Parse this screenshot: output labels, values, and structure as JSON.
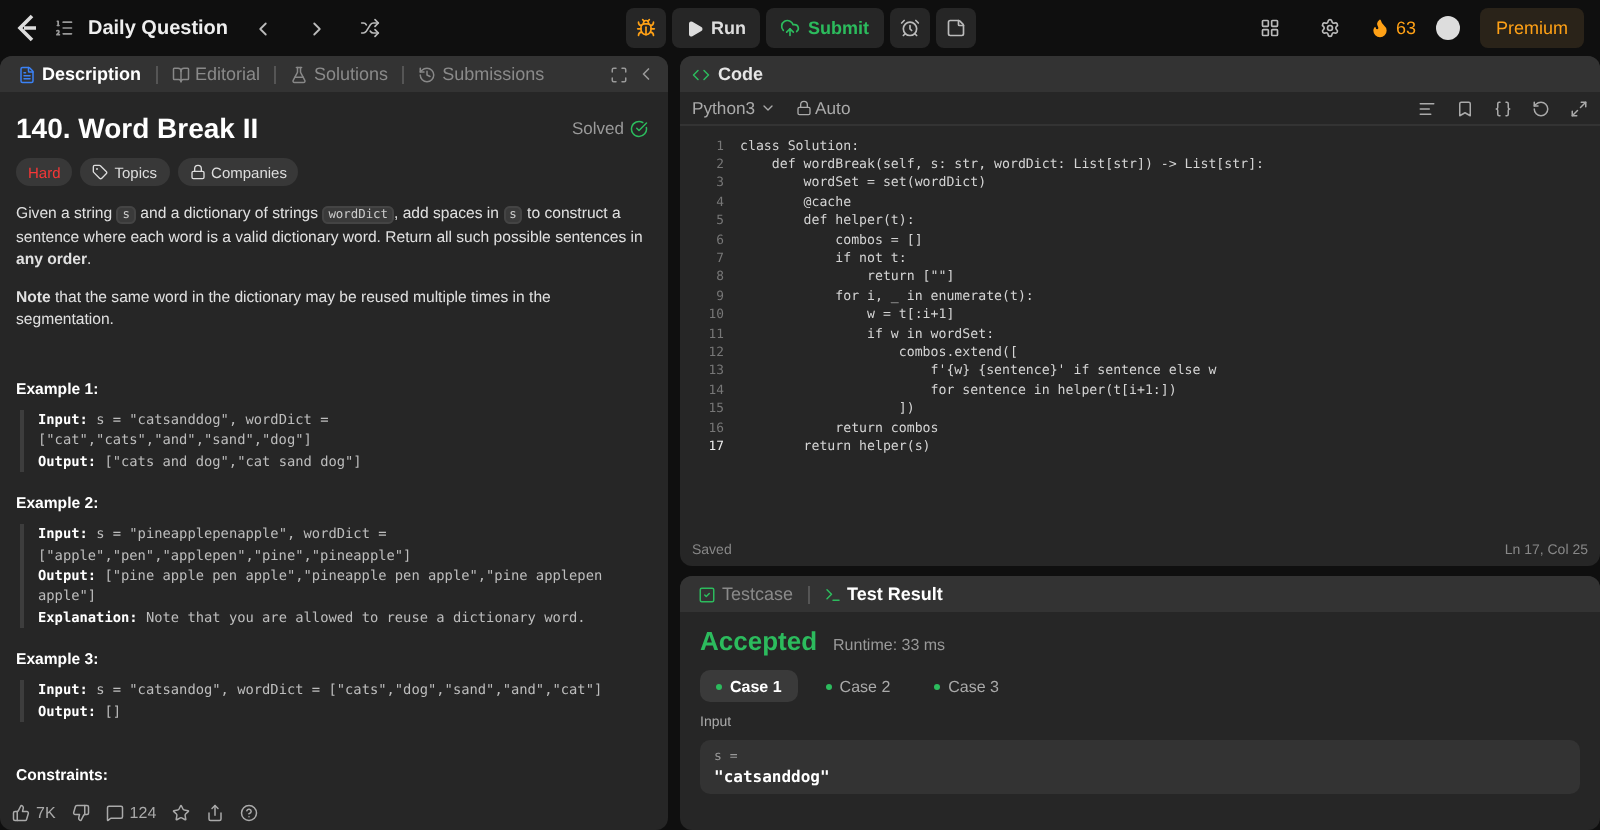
{
  "topbar": {
    "title": "Daily Question",
    "run": "Run",
    "submit": "Submit",
    "streak": "63",
    "premium": "Premium"
  },
  "left_tabs": [
    {
      "label": "Description",
      "selected": true
    },
    {
      "label": "Editorial",
      "selected": false
    },
    {
      "label": "Solutions",
      "selected": false
    },
    {
      "label": "Submissions",
      "selected": false
    }
  ],
  "problem": {
    "title": "140. Word Break II",
    "status": "Solved",
    "difficulty": "Hard",
    "tags": [
      "Topics",
      "Companies"
    ],
    "description": [
      {
        "kind": "text",
        "text": "Given a string "
      },
      {
        "kind": "code",
        "text": "s"
      },
      {
        "kind": "text",
        "text": " and a dictionary of strings "
      },
      {
        "kind": "code",
        "text": "wordDict"
      },
      {
        "kind": "text",
        "text": ", add spaces in "
      },
      {
        "kind": "code",
        "text": "s"
      },
      {
        "kind": "text",
        "text": " to construct a sentence where each word is a valid dictionary word. Return all such possible sentences in "
      },
      {
        "kind": "bold",
        "text": "any order"
      },
      {
        "kind": "text",
        "text": "."
      }
    ],
    "note": "**Note** that the same word in the dictionary may be reused multiple times in the segmentation.",
    "examples": [
      {
        "title": "Example 1:",
        "lines": [
          {
            "label": "Input:",
            "text": "s = \"catsanddog\", wordDict ="
          },
          {
            "text": "[\"cat\",\"cats\",\"and\",\"sand\",\"dog\"]"
          },
          {
            "label": "Output:",
            "text": "[\"cats and dog\",\"cat sand dog\"]"
          }
        ]
      },
      {
        "title": "Example 2:",
        "lines": [
          {
            "label": "Input:",
            "text": "s = \"pineapplepenapple\", wordDict ="
          },
          {
            "text": "[\"apple\",\"pen\",\"applepen\",\"pine\",\"pineapple\"]"
          },
          {
            "label": "Output:",
            "text": "[\"pine apple pen apple\",\"pineapple pen apple\",\"pine applepen"
          },
          {
            "text": "apple\"]"
          },
          {
            "label": "Explanation:",
            "text": "Note that you are allowed to reuse a dictionary word."
          }
        ]
      },
      {
        "title": "Example 3:",
        "lines": [
          {
            "label": "Input:",
            "text": "s = \"catsandog\", wordDict = [\"cats\",\"dog\",\"sand\",\"and\",\"cat\"]"
          },
          {
            "label": "Output:",
            "text": "[]"
          }
        ]
      }
    ],
    "constraints": "Constraints:"
  },
  "footer": {
    "likes": "7K",
    "comments": "124"
  },
  "code": {
    "title": "Code",
    "language": "Python3",
    "mode": "Auto",
    "status": "Saved",
    "position": "Ln 17, Col 25",
    "lines": [
      {
        "n": "1",
        "text": "class Solution:",
        "active": false
      },
      {
        "n": "2",
        "text": "    def wordBreak(self, s: str, wordDict: List[str]) -> List[str]:",
        "active": false
      },
      {
        "n": "3",
        "text": "        wordSet = set(wordDict)",
        "active": false
      },
      {
        "n": "4",
        "text": "        @cache",
        "active": false
      },
      {
        "n": "5",
        "text": "        def helper(t):",
        "active": false
      },
      {
        "n": "6",
        "text": "            combos = []",
        "active": false
      },
      {
        "n": "7",
        "text": "            if not t:",
        "active": false
      },
      {
        "n": "8",
        "text": "                return [\"\"]",
        "active": false
      },
      {
        "n": "9",
        "text": "            for i, _ in enumerate(t):",
        "active": false
      },
      {
        "n": "10",
        "text": "                w = t[:i+1]",
        "active": false
      },
      {
        "n": "11",
        "text": "                if w in wordSet:",
        "active": false
      },
      {
        "n": "12",
        "text": "                    combos.extend([",
        "active": false
      },
      {
        "n": "13",
        "text": "                        f'{w} {sentence}' if sentence else w",
        "active": false
      },
      {
        "n": "14",
        "text": "                        for sentence in helper(t[i+1:])",
        "active": false
      },
      {
        "n": "15",
        "text": "                    ])",
        "active": false
      },
      {
        "n": "16",
        "text": "            return combos",
        "active": false
      },
      {
        "n": "17",
        "text": "        return helper(s)",
        "active": true
      }
    ]
  },
  "result_tabs": [
    {
      "label": "Testcase",
      "selected": false
    },
    {
      "label": "Test Result",
      "selected": true
    }
  ],
  "result": {
    "verdict": "Accepted",
    "runtime": "Runtime: 33 ms",
    "cases": [
      {
        "label": "Case 1",
        "selected": true
      },
      {
        "label": "Case 2",
        "selected": false
      },
      {
        "label": "Case 3",
        "selected": false
      }
    ],
    "input_label": "Input",
    "var": "s =",
    "value": "\"catsanddog\""
  }
}
